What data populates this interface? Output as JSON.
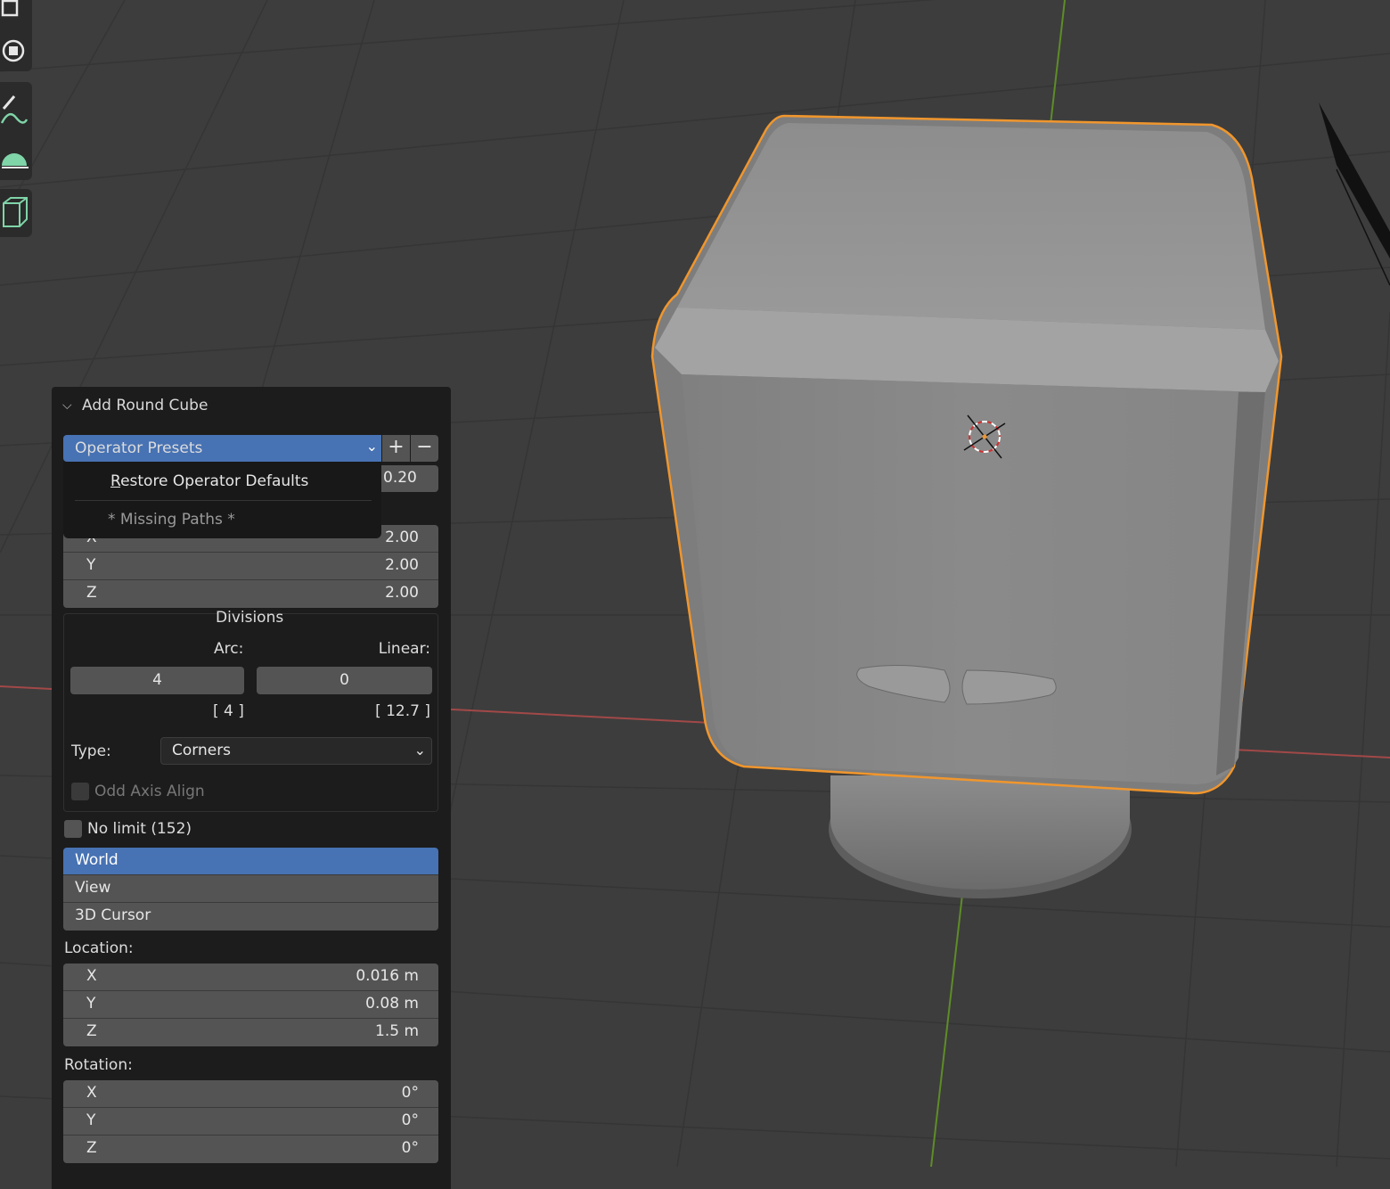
{
  "toolbar": {
    "tools": [
      {
        "icon": "select-box-icon"
      },
      {
        "icon": "transform-icon"
      },
      {
        "icon": "annotate-icon"
      },
      {
        "icon": "measure-icon"
      },
      {
        "icon": "add-cube-icon"
      }
    ]
  },
  "panel": {
    "title": "Add Round Cube",
    "presets": {
      "label": "Operator Presets",
      "add_label": "+",
      "remove_label": "−",
      "menu": {
        "restore_prefix": "R",
        "restore_rest": "estore Operator Defaults",
        "missing": "* Missing Paths *"
      }
    },
    "radius_value": "0.20",
    "size": [
      {
        "axis": "X",
        "value": "2.00"
      },
      {
        "axis": "Y",
        "value": "2.00"
      },
      {
        "axis": "Z",
        "value": "2.00"
      }
    ],
    "divisions": {
      "title": "Divisions",
      "arc_label": "Arc:",
      "linear_label": "Linear:",
      "arc_value": "4",
      "linear_value": "0",
      "arc_info": "[ 4 ]",
      "linear_info": "[ 12.7 ]",
      "type_label": "Type:",
      "type_value": "Corners",
      "odd_axis_label": "Odd Axis Align"
    },
    "no_limit_label": "No limit (152)",
    "align_options": [
      "World",
      "View",
      "3D Cursor"
    ],
    "align_selected": "World",
    "location_label": "Location:",
    "location": [
      {
        "axis": "X",
        "value": "0.016 m"
      },
      {
        "axis": "Y",
        "value": "0.08 m"
      },
      {
        "axis": "Z",
        "value": "1.5 m"
      }
    ],
    "rotation_label": "Rotation:",
    "rotation": [
      {
        "axis": "X",
        "value": "0°"
      },
      {
        "axis": "Y",
        "value": "0°"
      },
      {
        "axis": "Z",
        "value": "0°"
      }
    ]
  },
  "colors": {
    "accent": "#4772b3",
    "selection_outline": "#f0962d",
    "viewport_bg": "#3d3d3d",
    "axis_x": "#b04a4a",
    "axis_y": "#6a9a2a"
  }
}
